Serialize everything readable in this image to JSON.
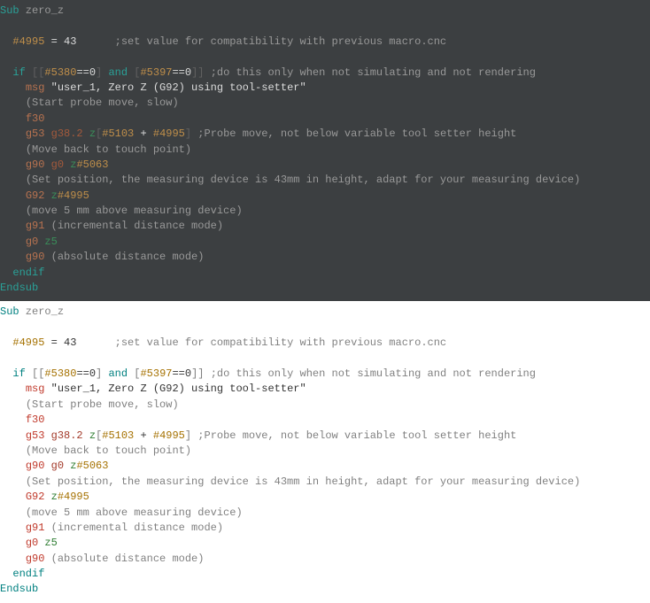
{
  "code": {
    "sub_kw": "Sub",
    "sub_name": " zero_z",
    "blank": "",
    "var1": "#4995",
    "eq": " = ",
    "val43": "43",
    "pad1": "      ",
    "c1": ";set value for compatibility with previous macro.cnc",
    "if_kw": "if",
    "lb": " [[",
    "var5380": "#5380",
    "eqeq": "==",
    "zero": "0",
    "rb1": "]",
    "and_kw": " and ",
    "lb2": "[",
    "var5397": "#5397",
    "rb2": "]]",
    "c2": " ;do this only when not simulating and not rendering",
    "msg": "msg",
    "msgtxt": " \"user_1, Zero Z (G92) using tool-setter\"",
    "c3": "(Start probe move, slow)",
    "f30": "f30",
    "g53": "g53",
    "g382": " g38.2",
    "z": " z",
    "lb3": "[",
    "var5103": "#5103",
    "plus": " + ",
    "var4995b": "#4995",
    "rb3": "]",
    "c4": " ;Probe move, not below variable tool setter height",
    "c5": "(Move back to touch point)",
    "g90a": "g90",
    "g0a": " g0",
    "z2": " z",
    "var5063": "#5063",
    "c6": "(Set position, the measuring device is 43mm in height, adapt for your measuring device)",
    "G92": "G92",
    "z3": " z",
    "var4995c": "#4995",
    "c7": "(move 5 mm above measuring device)",
    "g91": "g91",
    "c8": " (incremental distance mode)",
    "g0b": "g0",
    "z5": " z5",
    "g90b": "g90",
    "c9": " (absolute distance mode)",
    "endif": "endif",
    "endsub": "Endsub"
  }
}
